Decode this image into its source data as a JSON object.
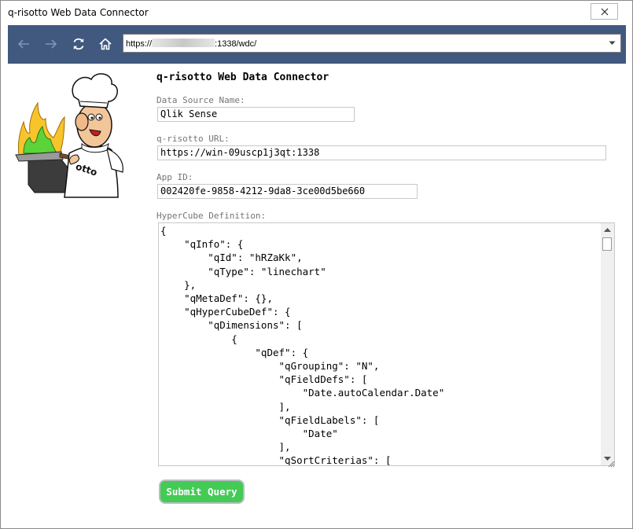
{
  "window": {
    "title": "q-risotto Web Data Connector"
  },
  "browser": {
    "url_prefix": "https://",
    "url_suffix": ":1338/wdc/"
  },
  "form": {
    "heading": "q-risotto Web Data Connector",
    "data_source": {
      "label": "Data Source Name:",
      "value": "Qlik Sense"
    },
    "url": {
      "label": "q-risotto URL:",
      "value": "https://win-09uscp1j3qt:1338"
    },
    "app_id": {
      "label": "App ID:",
      "value": "002420fe-9858-4212-9da8-3ce00d5be660"
    },
    "hypercube": {
      "label": "HyperCube Definition:",
      "value": "{\n    \"qInfo\": {\n        \"qId\": \"hRZaKk\",\n        \"qType\": \"linechart\"\n    },\n    \"qMetaDef\": {},\n    \"qHyperCubeDef\": {\n        \"qDimensions\": [\n            {\n                \"qDef\": {\n                    \"qGrouping\": \"N\",\n                    \"qFieldDefs\": [\n                        \"Date.autoCalendar.Date\"\n                    ],\n                    \"qFieldLabels\": [\n                        \"Date\"\n                    ],\n                    \"qSortCriterias\": ["
    },
    "submit_label": "Submit Query"
  },
  "colors": {
    "toolbar": "#41597f",
    "submit": "#43cb55"
  }
}
